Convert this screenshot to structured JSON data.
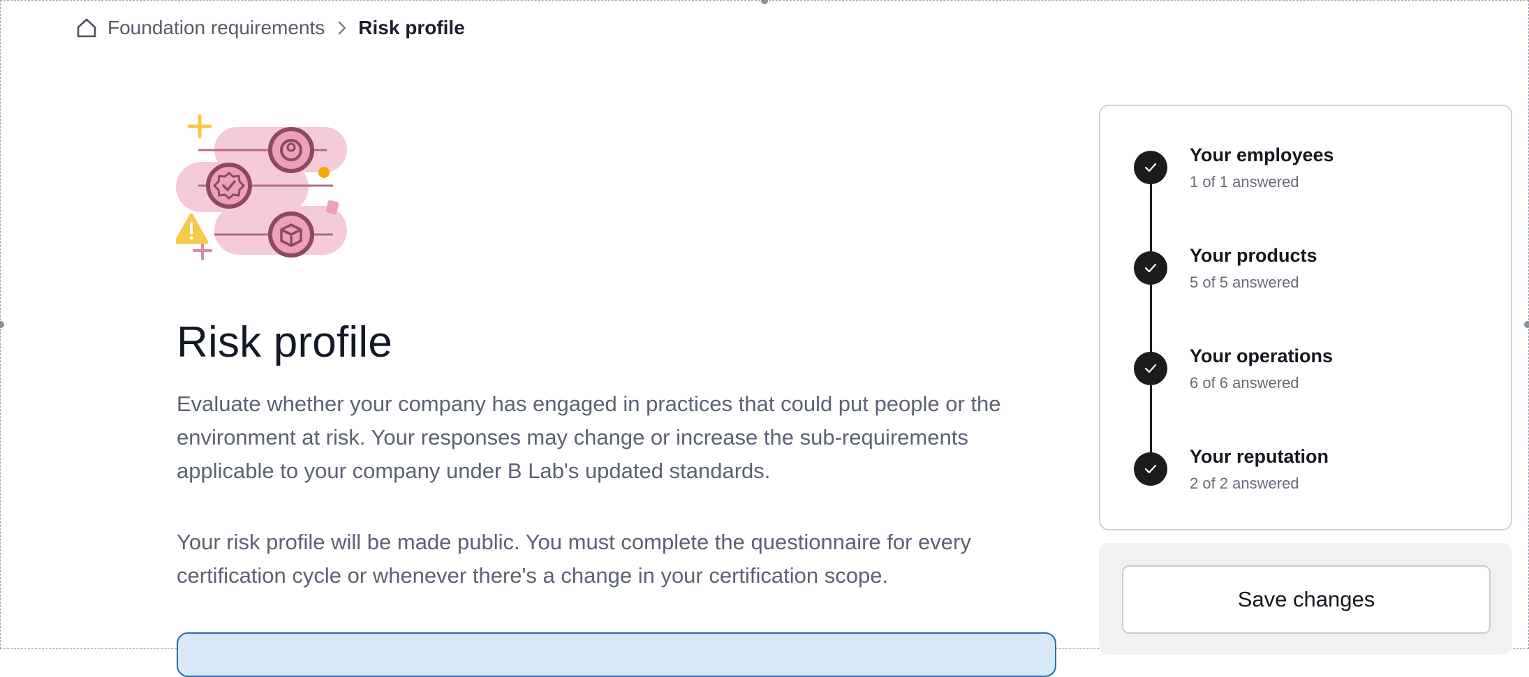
{
  "breadcrumb": {
    "home_icon": "home-icon",
    "parent": "Foundation requirements",
    "separator_icon": "chevron-right-icon",
    "current": "Risk profile"
  },
  "hero": {
    "illustration": "risk-sliders-illustration",
    "title": "Risk profile",
    "intro": "Evaluate whether your company has engaged in practices that could put people or the environment at risk. Your responses may change or increase the sub-requirements applicable to your company under B Lab's updated standards.",
    "notice": "Your risk profile will be made public. You must complete the questionnaire for every certification cycle or whenever there's a change in your certification scope."
  },
  "progress": {
    "steps": [
      {
        "title": "Your employees",
        "status": "1 of 1 answered",
        "icon": "check-icon"
      },
      {
        "title": "Your products",
        "status": "5 of 5 answered",
        "icon": "check-icon"
      },
      {
        "title": "Your operations",
        "status": "6 of 6 answered",
        "icon": "check-icon"
      },
      {
        "title": "Your reputation",
        "status": "2 of 2 answered",
        "icon": "check-icon"
      }
    ]
  },
  "actions": {
    "save_label": "Save changes"
  },
  "colors": {
    "accent_dark": "#1c1c1e",
    "banner_bg": "#d7e8f6",
    "banner_border": "#2b6aa8",
    "illustration_pink": "#f4c6d3",
    "illustration_rose": "#8a4a5f",
    "illustration_yellow": "#f7c948"
  }
}
